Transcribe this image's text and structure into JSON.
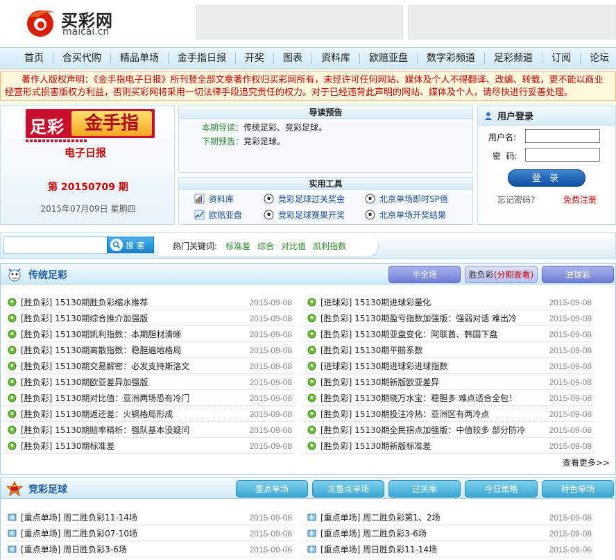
{
  "header": {
    "logo_cn": "买彩网",
    "logo_en": "maicai.cn"
  },
  "nav": {
    "items": [
      "首页",
      "合买代购",
      "精品单场",
      "金手指日报",
      "开奖",
      "图表",
      "资料库",
      "欧赔亚盘",
      "数字彩频道",
      "足彩频道",
      "订阅",
      "论坛"
    ]
  },
  "notice": {
    "text": "著作人版权声明：《金手指电子日报》所刊登全部文章著作权归买彩网所有，未经许可任何网站、媒体及个人不得翻译、改编、转载，更不能以商业经营形式损害版权方利益，否则买彩网将采用一切法律手段追究责任的权力。对于已经违背此声明的网站、媒体及个人，请尽快进行妥善处理。"
  },
  "ebook": {
    "banner_left": "足彩",
    "banner_right": "金手指",
    "subtitle": "电子日报",
    "issue": "第 20150709 期",
    "date": "2015年07月09日 星期四"
  },
  "guide": {
    "title": "导读预告",
    "current_label": "本期导读：",
    "current_value": "传统足彩、竞彩足球。",
    "next_label": "下期预告：",
    "next_value": "竞彩足球。"
  },
  "tools": {
    "title": "实用工具",
    "items": [
      "资料库",
      "竞彩足球过关奖金",
      "北京单场即时SP值",
      "欧赔亚盘",
      "竞彩足球赛果开奖",
      "北京单场开奖结果"
    ]
  },
  "login": {
    "title": "用户登录",
    "username_label": "用户名:",
    "password_label": "密  码:",
    "button": "登 录",
    "forgot": "忘记密码?",
    "register": "免费注册"
  },
  "search": {
    "button": "搜 索",
    "hot_label": "热门关键词:",
    "keywords": [
      "标准差",
      "综合",
      "对比值",
      "凯利指数"
    ]
  },
  "traditional": {
    "title": "传统足彩",
    "tabs": [
      "半全场",
      "胜负彩",
      "(分期查看)",
      "进球彩"
    ],
    "more": "查看更多>>",
    "left": [
      {
        "title": "[胜负彩] 15130期胜负彩缩水推荐",
        "date": "2015-09-08"
      },
      {
        "title": "[胜负彩] 15130期综合推介加强版",
        "date": "2015-09-08"
      },
      {
        "title": "[胜负彩] 15130期凯利指数：本期胆材清晰",
        "date": "2015-09-08"
      },
      {
        "title": "[胜负彩] 15130期离散指数：稳胆遍地格局",
        "date": "2015-09-08"
      },
      {
        "title": "[胜负彩] 15130期交易解密：必发支持斯洛文",
        "date": "2015-09-08"
      },
      {
        "title": "[胜负彩] 15130期欧亚差异加强版",
        "date": "2015-09-08"
      },
      {
        "title": "[胜负彩] 15130期对比值：亚洲两场恐有冷门",
        "date": "2015-09-08"
      },
      {
        "title": "[胜负彩] 15130期返还差：火锅格局形成",
        "date": "2015-09-08"
      },
      {
        "title": "[胜负彩] 15130期赔率精析：强队基本没疑问",
        "date": "2015-09-08"
      },
      {
        "title": "[胜负彩] 15130期标准差",
        "date": "2015-09-08"
      }
    ],
    "right": [
      {
        "title": "[进球彩] 15130期进球彩量化",
        "date": "2015-09-08"
      },
      {
        "title": "[胜负彩] 15130期盈亏指数加强版：强弱对话 难出冷",
        "date": "2015-09-08"
      },
      {
        "title": "[胜负彩] 15130期亚盘变化：阿联酋、韩国下盘",
        "date": "2015-09-08"
      },
      {
        "title": "[胜负彩] 15130期平赔系数",
        "date": "2015-09-08"
      },
      {
        "title": "[进球彩] 15130期进球彩进球指数",
        "date": "2015-09-08"
      },
      {
        "title": "[胜负彩] 15130期新版欧亚差异",
        "date": "2015-09-08"
      },
      {
        "title": "[胜负彩] 15130期晓万水宝：稳胆多 难点适合全包！",
        "date": "2015-09-08"
      },
      {
        "title": "[胜负彩] 15130期投注冷热：亚洲区有两冷点",
        "date": "2015-09-08"
      },
      {
        "title": "[胜负彩] 15130期全民拐点加强版：中值较多 部分防冷",
        "date": "2015-09-08"
      },
      {
        "title": "[胜负彩] 15130期新版标准差",
        "date": "2015-09-08"
      }
    ]
  },
  "jingcai": {
    "title": "竞彩足球",
    "tabs": [
      "重点单场",
      "次重点单场",
      "过关串",
      "今日策略",
      "特色单场"
    ],
    "left": [
      {
        "title": "[重点单场] 周二胜负彩11-14场",
        "date": "2015-09-08"
      },
      {
        "title": "[重点单场] 周二胜负彩07-10场",
        "date": "2015-09-08"
      },
      {
        "title": "[重点单场] 周日胜负彩3-6场",
        "date": "2015-09-06"
      }
    ],
    "right": [
      {
        "title": "[重点单场] 周二胜负彩第1、2场",
        "date": "2015-09-08"
      },
      {
        "title": "[重点单场] 周二胜负彩3-6场",
        "date": "2015-09-08"
      },
      {
        "title": "[重点单场] 周日胜负彩11-14场",
        "date": "2015-09-06"
      }
    ]
  }
}
